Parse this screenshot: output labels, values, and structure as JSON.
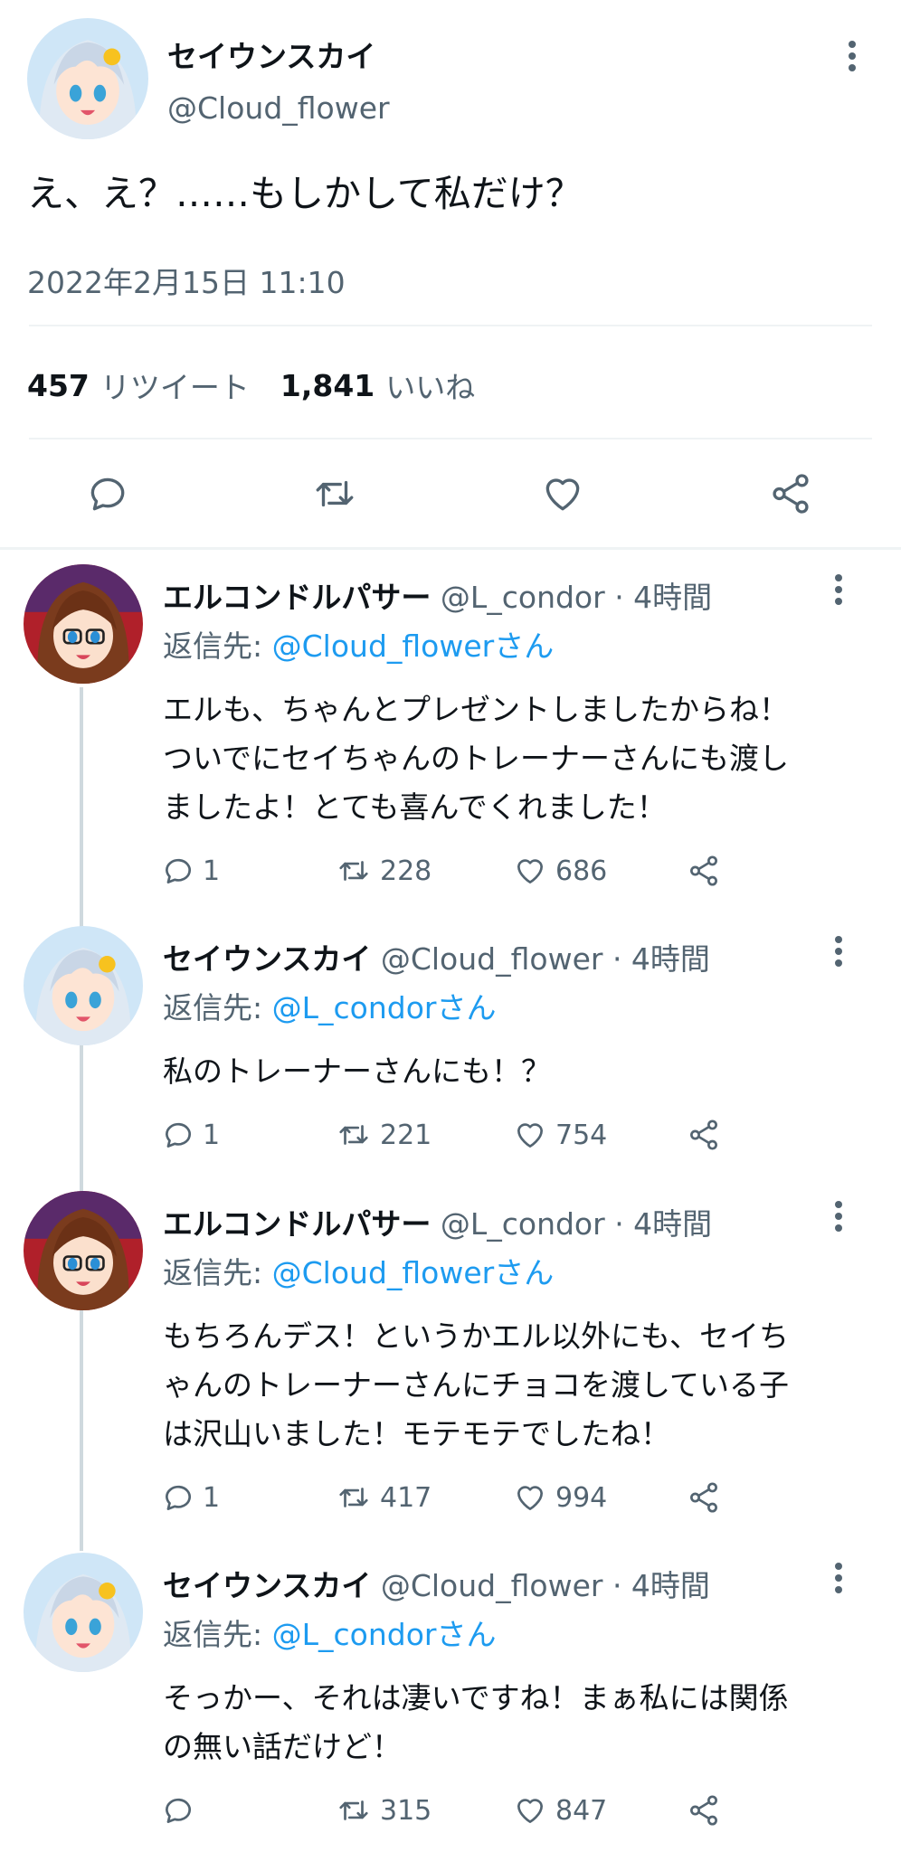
{
  "main_tweet": {
    "display_name": "セイウンスカイ",
    "handle": "@Cloud_flower",
    "text": "え、え？……もしかして私だけ？",
    "timestamp": "2022年2月15日 11:10",
    "retweets_count": "457",
    "retweets_label": "リツイート",
    "likes_count": "1,841",
    "likes_label": "いいね"
  },
  "replies": [
    {
      "display_name": "エルコンドルパサー",
      "handle": "@L_condor",
      "time": "· 4時間",
      "reply_prefix": "返信先:",
      "reply_to": "@Cloud_flowerさん",
      "text": [
        "エルも、ちゃんとプレゼントしましたからね！",
        "ついでにセイちゃんのトレーナーさんにも渡し",
        "ましたよ！とても喜んでくれました！"
      ],
      "replies": "1",
      "retweets": "228",
      "likes": "686"
    },
    {
      "display_name": "セイウンスカイ",
      "handle": "@Cloud_flower",
      "time": "· 4時間",
      "reply_prefix": "返信先:",
      "reply_to": "@L_condorさん",
      "text": [
        "私のトレーナーさんにも！？"
      ],
      "replies": "1",
      "retweets": "221",
      "likes": "754"
    },
    {
      "display_name": "エルコンドルパサー",
      "handle": "@L_condor",
      "time": "· 4時間",
      "reply_prefix": "返信先:",
      "reply_to": "@Cloud_flowerさん",
      "text": [
        "もちろんデス！というかエル以外にも、セイち",
        "ゃんのトレーナーさんにチョコを渡している子",
        "は沢山いました！モテモテでしたね！"
      ],
      "replies": "1",
      "retweets": "417",
      "likes": "994"
    },
    {
      "display_name": "セイウンスカイ",
      "handle": "@Cloud_flower",
      "time": "· 4時間",
      "reply_prefix": "返信先:",
      "reply_to": "@L_condorさん",
      "text": [
        "そっかー、それは凄いですね！まぁ私には関係",
        "の無い話だけど！"
      ],
      "replies": "",
      "retweets": "315",
      "likes": "847"
    }
  ],
  "icons": {
    "reply": "reply-icon",
    "retweet": "retweet-icon",
    "like": "heart-icon",
    "share": "share-icon",
    "more": "more-icon"
  },
  "colors": {
    "link": "#1d9bf0",
    "secondary_text": "#536471",
    "divider": "#eff3f4"
  }
}
